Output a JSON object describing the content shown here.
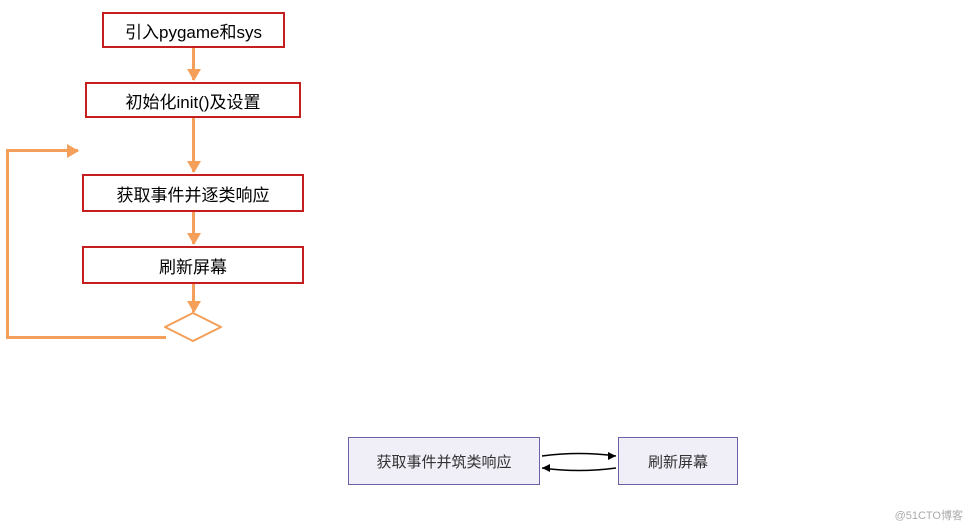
{
  "flowchart": {
    "boxes": {
      "step1": "引入pygame和sys",
      "step2": "初始化init()及设置",
      "step3": "获取事件并逐类响应",
      "step4": "刷新屏幕"
    },
    "colors": {
      "box_border": "#c41e1e",
      "arrow": "#f5a05a",
      "bottom_border": "#6b5fa5",
      "bottom_fill": "#f0eef6"
    }
  },
  "bottom_diagram": {
    "left_box": "获取事件并筑类响应",
    "right_box": "刷新屏幕"
  },
  "watermark": "@51CTO博客"
}
